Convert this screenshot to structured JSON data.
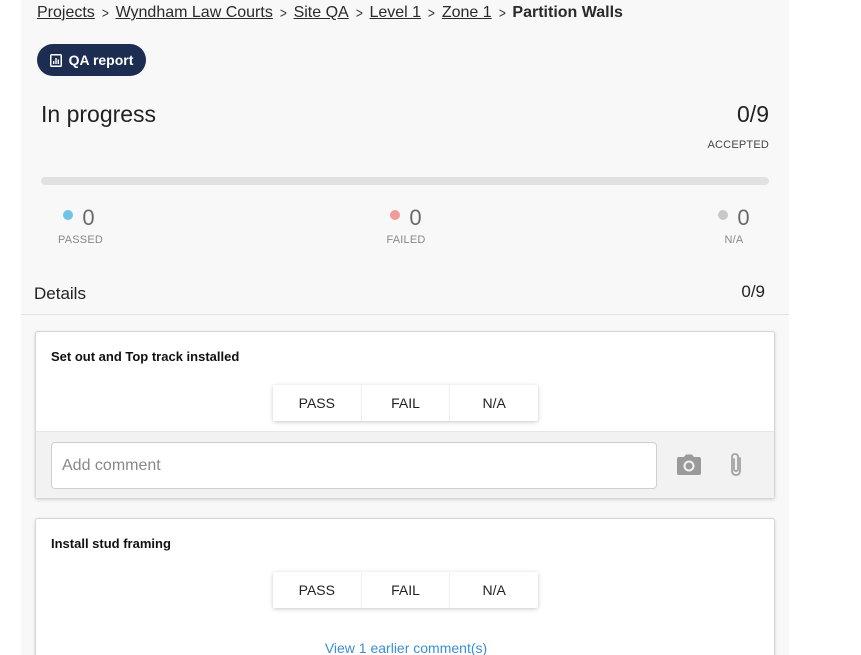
{
  "breadcrumb": {
    "items": [
      "Projects",
      "Wyndham Law Courts",
      "Site QA",
      "Level 1",
      "Zone 1"
    ],
    "current": "Partition Walls"
  },
  "qa_report_label": "QA report",
  "status": {
    "title": "In progress",
    "accepted_count": "0/9",
    "accepted_label": "ACCEPTED",
    "progress_fraction": 0
  },
  "stats": {
    "passed": {
      "count": "0",
      "label": "PASSED",
      "color": "#6fc3e6"
    },
    "failed": {
      "count": "0",
      "label": "FAILED",
      "color": "#f19a9a"
    },
    "na": {
      "count": "0",
      "label": "N/A",
      "color": "#c8c8c8"
    }
  },
  "details": {
    "title": "Details",
    "count": "0/9"
  },
  "items": [
    {
      "title": "Set out and Top track installed",
      "options": [
        "PASS",
        "FAIL",
        "N/A"
      ],
      "comment_placeholder": "Add comment"
    },
    {
      "title": "Install stud framing",
      "options": [
        "PASS",
        "FAIL",
        "N/A"
      ],
      "earlier_comments_link": "View 1 earlier comment(s)"
    }
  ]
}
